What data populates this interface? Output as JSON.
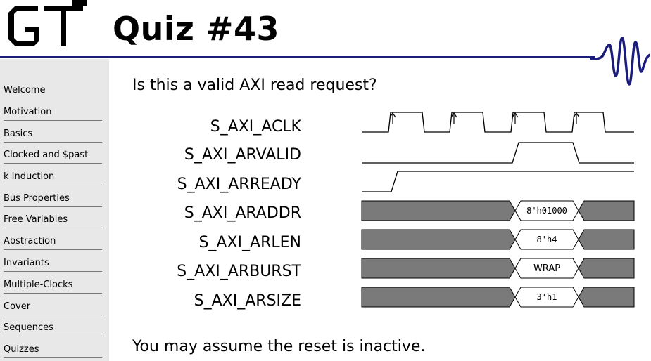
{
  "header": {
    "title": "Quiz #43"
  },
  "sidebar": {
    "items": [
      {
        "label": "Welcome"
      },
      {
        "label": "Motivation"
      },
      {
        "label": "Basics"
      },
      {
        "label": "Clocked and $past"
      },
      {
        "label": "k Induction"
      },
      {
        "label": "Bus Properties"
      },
      {
        "label": "Free Variables"
      },
      {
        "label": "Abstraction"
      },
      {
        "label": "Invariants"
      },
      {
        "label": "Multiple-Clocks"
      },
      {
        "label": "Cover"
      },
      {
        "label": "Sequences"
      },
      {
        "label": "Quizzes"
      }
    ]
  },
  "question": "Is this a valid AXI read request?",
  "signals": [
    {
      "name": "S_AXI_ACLK"
    },
    {
      "name": "S_AXI_ARVALID"
    },
    {
      "name": "S_AXI_ARREADY"
    },
    {
      "name": "S_AXI_ARADDR",
      "value": "8'h01000"
    },
    {
      "name": "S_AXI_ARLEN",
      "value": "8'h4"
    },
    {
      "name": "S_AXI_ARBURST",
      "value": "WRAP"
    },
    {
      "name": "S_AXI_ARSIZE",
      "value": "3'h1"
    }
  ],
  "footer": "You may assume the reset is inactive.",
  "colors": {
    "title_rule": "#1c1c7a",
    "sidebar_bg": "#e8e8e8",
    "bus_fill": "#7a7a7a"
  }
}
